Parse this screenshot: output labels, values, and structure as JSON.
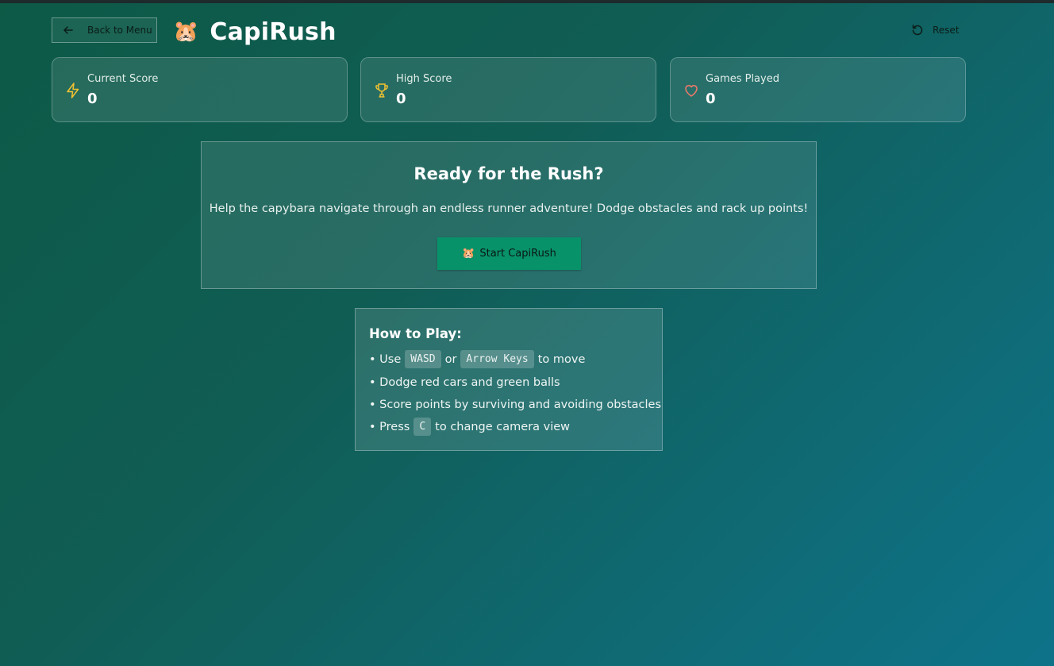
{
  "header": {
    "back_label": "Back to Menu",
    "title": "CapiRush",
    "title_emoji": "🐹",
    "reset_label": "Reset"
  },
  "stats": [
    {
      "label": "Current Score",
      "value": "0",
      "icon": "lightning-icon",
      "color": "#f1c232"
    },
    {
      "label": "High Score",
      "value": "0",
      "icon": "trophy-icon",
      "color": "#f1c232"
    },
    {
      "label": "Games Played",
      "value": "0",
      "icon": "heart-icon",
      "color": "#f07a6a"
    }
  ],
  "ready": {
    "title": "Ready for the Rush?",
    "description": "Help the capybara navigate through an endless runner adventure! Dodge obstacles and rack up points!",
    "start_emoji": "🐹",
    "start_label": "Start CapiRush"
  },
  "howto": {
    "title": "How to Play:",
    "line1_pre": "• Use",
    "key_wasd": "WASD",
    "line1_or": "or",
    "key_arrows": "Arrow Keys",
    "line1_post": "to move",
    "line2": "• Dodge red cars and green balls",
    "line3": "• Score points by surviving and avoiding obstacles",
    "line4_pre": "• Press",
    "key_c": "C",
    "line4_post": "to change camera view"
  },
  "colors": {
    "accent_button": "#08926a",
    "background_start": "#0d5a47",
    "background_end": "#0e7389"
  }
}
